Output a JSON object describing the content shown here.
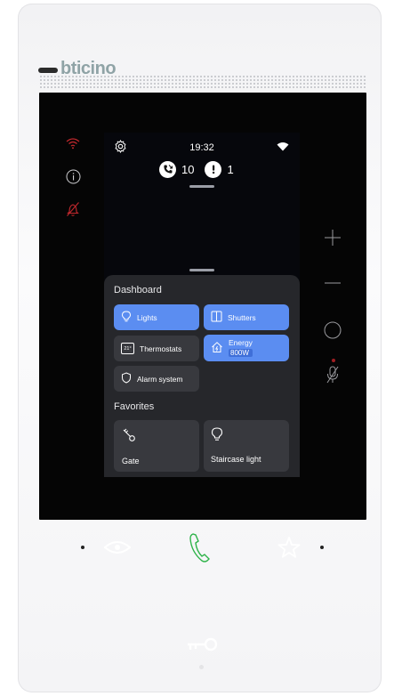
{
  "brand": {
    "name": "bticino"
  },
  "screen": {
    "status": {
      "time": "19:32"
    },
    "notifications": {
      "calls_count": "10",
      "alerts_count": "1"
    },
    "dashboard": {
      "title": "Dashboard",
      "tiles": [
        {
          "label": "Lights",
          "state": "on"
        },
        {
          "label": "Shutters",
          "state": "on"
        },
        {
          "label": "Thermostats",
          "state": "off",
          "icon_text": "21°"
        },
        {
          "label": "Energy",
          "value": "800W",
          "state": "on"
        },
        {
          "label": "Alarm system",
          "state": "off"
        }
      ]
    },
    "favorites": {
      "title": "Favorites",
      "items": [
        {
          "label": "Gate"
        },
        {
          "label": "Staircase light"
        }
      ]
    }
  },
  "colors": {
    "tile_active": "#5b8df1",
    "tile_inactive": "#38393e",
    "panel": "#26272b",
    "alert_red": "#c0282d",
    "call_green": "#2fb34a"
  },
  "icons": {
    "left": [
      "wifi-icon",
      "info-icon",
      "mute-icon"
    ],
    "right": [
      "plus-icon",
      "minus-icon",
      "circle-button-icon",
      "mic-off-icon"
    ],
    "bottom": [
      "eye-icon",
      "phone-icon",
      "star-icon",
      "key-icon"
    ]
  }
}
